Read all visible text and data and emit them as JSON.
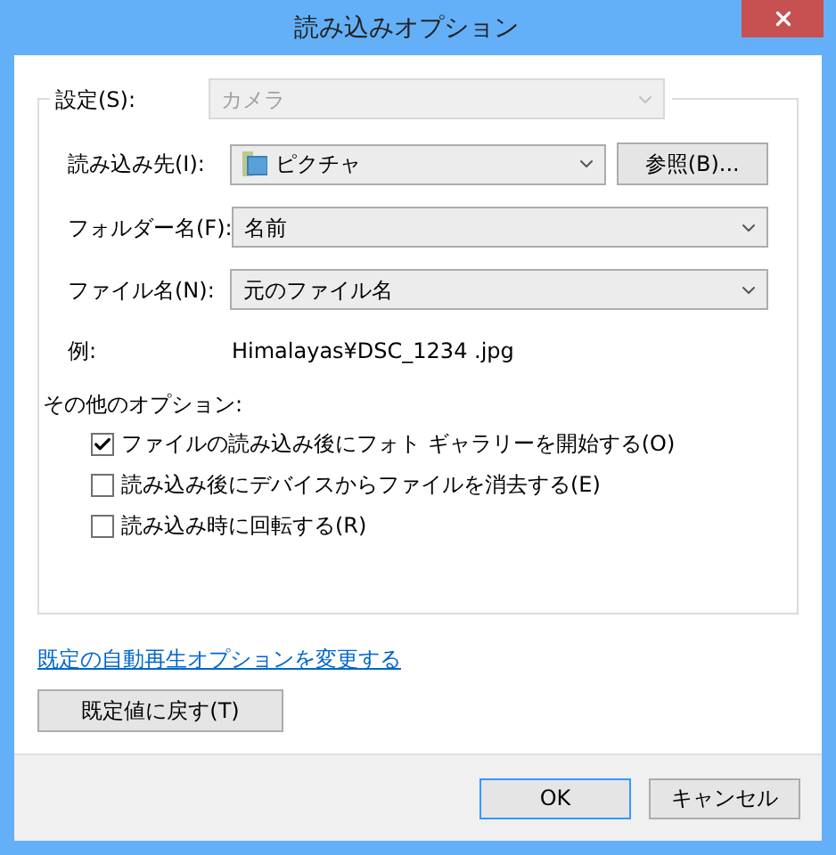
{
  "window": {
    "title": "読み込みオプション"
  },
  "settings": {
    "label": "設定(S):",
    "value": "カメラ",
    "disabled": true
  },
  "import_to": {
    "label": "読み込み先(I):",
    "value": "ピクチャ",
    "browse_button": "参照(B)..."
  },
  "folder_name": {
    "label": "フォルダー名(F):",
    "value": "名前"
  },
  "file_name": {
    "label": "ファイル名(N):",
    "value": "元のファイル名"
  },
  "example": {
    "label": "例:",
    "value": "Himalayas¥DSC_1234 .jpg"
  },
  "other_options": {
    "label": "その他のオプション:",
    "options": [
      {
        "label": "ファイルの読み込み後にフォト ギャラリーを開始する(O)",
        "checked": true
      },
      {
        "label": "読み込み後にデバイスからファイルを消去する(E)",
        "checked": false
      },
      {
        "label": "読み込み時に回転する(R)",
        "checked": false
      }
    ]
  },
  "link": "既定の自動再生オプションを変更する",
  "reset_button": "既定値に戻す(T)",
  "buttons": [
    {
      "label": "OK",
      "default": true
    },
    {
      "label": "キャンセル",
      "default": false
    }
  ]
}
